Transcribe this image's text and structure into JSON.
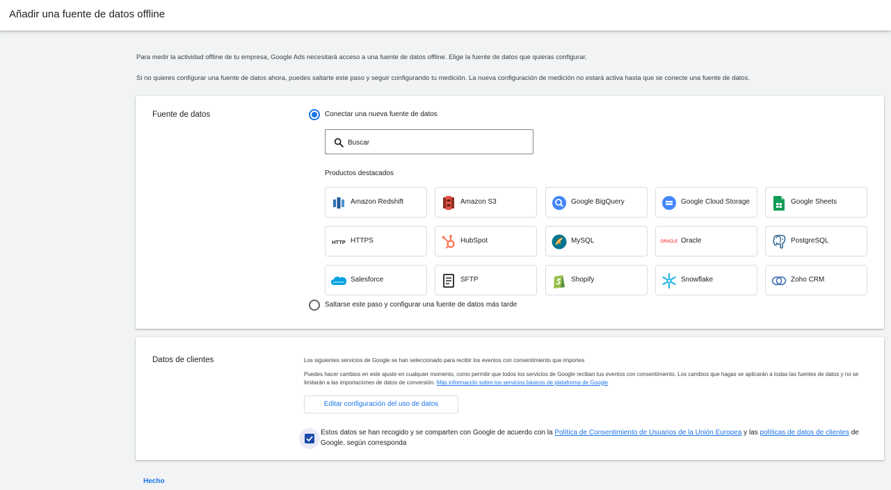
{
  "header": {
    "title": "Añadir una fuente de datos offline"
  },
  "intro": {
    "line1": "Para medir la actividad offline de tu empresa, Google Ads necesitará acceso a una fuente de datos offline. Elige la fuente de datos que quieras configurar.",
    "line2": "Si no quieres configurar una fuente de datos ahora, puedes saltarte este paso y seguir configurando tu medición. La nueva configuración de medición no estará activa hasta que se conecte una fuente de datos."
  },
  "data_source": {
    "label": "Fuente de datos",
    "option_connect": "Conectar una nueva fuente de datos",
    "search_placeholder": "Buscar",
    "featured_label": "Productos destacados",
    "products": [
      {
        "label": "Amazon Redshift",
        "icon": "amazon-redshift-icon"
      },
      {
        "label": "Amazon S3",
        "icon": "amazon-s3-icon"
      },
      {
        "label": "Google BigQuery",
        "icon": "google-bigquery-icon"
      },
      {
        "label": "Google Cloud Storage",
        "icon": "google-cloud-storage-icon"
      },
      {
        "label": "Google Sheets",
        "icon": "google-sheets-icon"
      },
      {
        "label": "HTTPS",
        "icon": "http-icon",
        "icon_text": "HTTP"
      },
      {
        "label": "HubSpot",
        "icon": "hubspot-icon"
      },
      {
        "label": "MySQL",
        "icon": "mysql-icon"
      },
      {
        "label": "Oracle",
        "icon": "oracle-icon",
        "icon_text": "ORACLE"
      },
      {
        "label": "PostgreSQL",
        "icon": "postgresql-icon"
      },
      {
        "label": "Salesforce",
        "icon": "salesforce-icon",
        "icon_text": "salesforce"
      },
      {
        "label": "SFTP",
        "icon": "sftp-icon"
      },
      {
        "label": "Shopify",
        "icon": "shopify-icon"
      },
      {
        "label": "Snowflake",
        "icon": "snowflake-icon"
      },
      {
        "label": "Zoho CRM",
        "icon": "zoho-crm-icon"
      }
    ],
    "option_skip": "Saltarse este paso y configurar una fuente de datos más tarde"
  },
  "customer_data": {
    "label": "Datos de clientes",
    "line1": "Los siguientes servicios de Google se han seleccionado para recibir los eventos con consentimiento que importes",
    "line2": "Puedes hacer cambios en este ajuste en cualquier momento, como permitir que todos los servicios de Google reciban tus eventos con consentimiento. Los cambios que hagas se aplicarán a todas las fuentes de datos y no se limitarán a las importaciones de datos de conversión.",
    "learn_more": "Más información sobre los servicios básicos de plataforma de Google",
    "edit_button": "Editar configuración del uso de datos",
    "consent_prefix": "Estos datos se han recogido y se comparten con Google de acuerdo con la",
    "consent_link1": "Política de Consentimiento de Usuarios de la Unión Europea",
    "consent_mid": "y las",
    "consent_link2": "políticas de datos de clientes",
    "consent_suffix": "de Google, según corresponda"
  },
  "footer": {
    "done_label": "Hecho"
  },
  "colors": {
    "accent": "#1a73e8",
    "checkbox": "#1a4aa8",
    "background": "#f1f3f4"
  }
}
